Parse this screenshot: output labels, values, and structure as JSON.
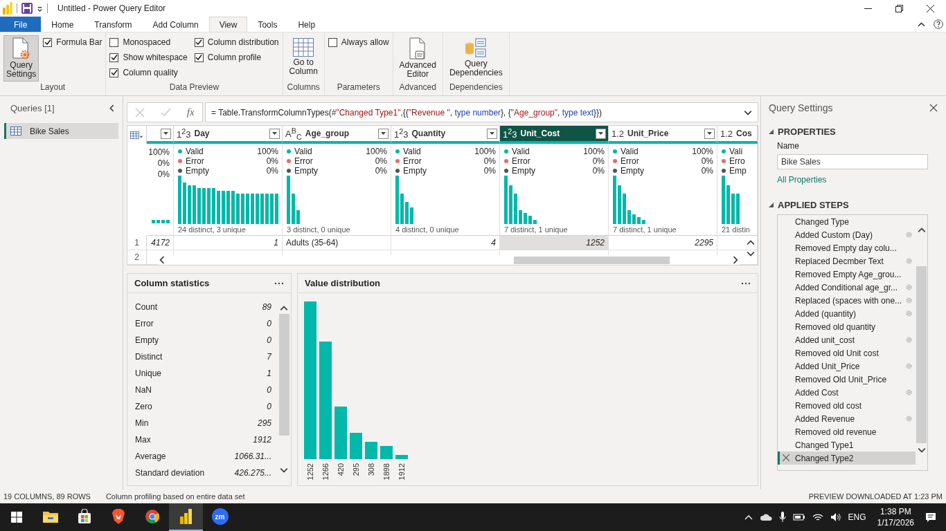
{
  "title_bar": {
    "title": "Untitled - Power Query Editor"
  },
  "ribbon_tabs": [
    {
      "label": "File",
      "kind": "file",
      "selected": false
    },
    {
      "label": "Home",
      "kind": "tab",
      "selected": false
    },
    {
      "label": "Transform",
      "kind": "tab",
      "selected": false
    },
    {
      "label": "Add Column",
      "kind": "tab",
      "selected": false
    },
    {
      "label": "View",
      "kind": "tab",
      "selected": true
    },
    {
      "label": "Tools",
      "kind": "tab",
      "selected": false
    },
    {
      "label": "Help",
      "kind": "tab",
      "selected": false
    }
  ],
  "ribbon_groups": [
    {
      "label": "Layout",
      "items": [
        {
          "kind": "big",
          "label": "Query Settings",
          "selected": true
        },
        {
          "kind": "check",
          "label": "Formula Bar",
          "checked": true
        }
      ]
    },
    {
      "label": "Data Preview",
      "items": [
        {
          "kind": "check",
          "label": "Monospaced",
          "checked": false
        },
        {
          "kind": "check",
          "label": "Show whitespace",
          "checked": true
        },
        {
          "kind": "check",
          "label": "Column quality",
          "checked": true
        },
        {
          "kind": "check",
          "label": "Column distribution",
          "checked": true
        },
        {
          "kind": "check",
          "label": "Column profile",
          "checked": true
        }
      ]
    },
    {
      "label": "Columns",
      "items": [
        {
          "kind": "big",
          "label": "Go to Column",
          "selected": false
        }
      ]
    },
    {
      "label": "Parameters",
      "items": [
        {
          "kind": "check",
          "label": "Always allow",
          "checked": false
        }
      ]
    },
    {
      "label": "Advanced",
      "items": [
        {
          "kind": "big",
          "label": "Advanced Editor",
          "selected": false
        }
      ]
    },
    {
      "label": "Dependencies",
      "items": [
        {
          "kind": "big",
          "label": "Query Dependencies",
          "selected": false
        }
      ]
    }
  ],
  "queries": {
    "title": "Queries [1]",
    "items": [
      {
        "label": "Bike Sales",
        "selected": true
      }
    ]
  },
  "formula_bar": {
    "function_label": "fx",
    "formula": "= Table.TransformColumnTypes(#\"Changed Type1\",{{\"Revenue \", type number}, {\"Age_group\", type text}})"
  },
  "grid": {
    "columns": [
      {
        "kind": "number",
        "selected": false,
        "quality": [
          {
            "value": "100%"
          },
          {
            "value": "0%"
          },
          {
            "value": "0%"
          }
        ]
      },
      {
        "kind": "number",
        "type_label": "1$^{2}$3",
        "name": "Day",
        "selected": false,
        "quality": [
          {
            "label": "Valid",
            "value": "100%",
            "color": "#01b8aa"
          },
          {
            "label": "Error",
            "value": "0%",
            "color": "#e66c6c"
          },
          {
            "label": "Empty",
            "value": "0%",
            "color": "#555555"
          }
        ],
        "distinct": "24 distinct, 3 unique"
      },
      {
        "kind": "text",
        "type_label": "A$^{B}$$_{C}$",
        "name": "Age_group",
        "selected": false,
        "quality": [
          {
            "label": "Valid",
            "value": "100%",
            "color": "#01b8aa"
          },
          {
            "label": "Error",
            "value": "0%",
            "color": "#e66c6c"
          },
          {
            "label": "Empty",
            "value": "0%",
            "color": "#555555"
          }
        ],
        "distinct": "3 distinct, 0 unique"
      },
      {
        "kind": "number",
        "type_label": "1$^{2}$3",
        "name": "Quantity",
        "selected": false,
        "quality": [
          {
            "label": "Valid",
            "value": "100%",
            "color": "#01b8aa"
          },
          {
            "label": "Error",
            "value": "0%",
            "color": "#e66c6c"
          },
          {
            "label": "Empty",
            "value": "0%",
            "color": "#555555"
          }
        ],
        "distinct": "4 distinct, 0 unique"
      },
      {
        "kind": "number",
        "type_label": "1$^{2}$3",
        "name": "Unit_Cost",
        "selected": true,
        "quality": [
          {
            "label": "Valid",
            "value": "100%",
            "color": "#01b8aa"
          },
          {
            "label": "Error",
            "value": "0%",
            "color": "#e66c6c"
          },
          {
            "label": "Empty",
            "value": "0%",
            "color": "#555555"
          }
        ],
        "distinct": "7 distinct, 1 unique"
      },
      {
        "kind": "number",
        "type_label": "1.2",
        "name": "Unit_Price",
        "selected": false,
        "quality": [
          {
            "label": "Valid",
            "value": "100%",
            "color": "#01b8aa"
          },
          {
            "label": "Error",
            "value": "0%",
            "color": "#e66c6c"
          },
          {
            "label": "Empty",
            "value": "0%",
            "color": "#555555"
          }
        ],
        "distinct": "7 distinct, 1 unique"
      },
      {
        "kind": "number",
        "type_label": "1.2",
        "name": "Cos",
        "selected": false,
        "quality": [
          {
            "label": "Vali",
            "color": "#01b8aa"
          },
          {
            "label": "Erro",
            "color": "#e66c6c"
          },
          {
            "label": "Emp",
            "color": "#555555"
          }
        ],
        "distinct": "21 distin"
      }
    ],
    "rows": [
      {
        "number": "1",
        "cells": [
          "4172",
          "1",
          "Adults (35-64)",
          "4",
          "1252",
          "2295"
        ]
      },
      {
        "number": "2",
        "cells": []
      }
    ]
  },
  "column_statistics": {
    "title": "Column statistics",
    "rows": [
      {
        "label": "Count",
        "value": "89"
      },
      {
        "label": "Error",
        "value": "0"
      },
      {
        "label": "Empty",
        "value": "0"
      },
      {
        "label": "Distinct",
        "value": "7"
      },
      {
        "label": "Unique",
        "value": "1"
      },
      {
        "label": "NaN",
        "value": "0"
      },
      {
        "label": "Zero",
        "value": "0"
      },
      {
        "label": "Min",
        "value": "295"
      },
      {
        "label": "Max",
        "value": "1912"
      },
      {
        "label": "Average",
        "value": "1066.31..."
      },
      {
        "label": "Standard deviation",
        "value": "426.275..."
      }
    ]
  },
  "value_distribution": {
    "title": "Value distribution",
    "labels": [
      "1252",
      "1266",
      "420",
      "295",
      "308",
      "1898",
      "1912"
    ]
  },
  "query_settings": {
    "title": "Query Settings",
    "properties": {
      "heading": "PROPERTIES",
      "name_label": "Name",
      "name_value": "Bike Sales",
      "link": "All Properties"
    },
    "applied_steps": {
      "heading": "APPLIED STEPS",
      "steps": [
        {
          "label": "Changed Type",
          "settings": false,
          "selected": false
        },
        {
          "label": "Added Custom (Day)",
          "settings": true,
          "selected": false
        },
        {
          "label": "Removed Empty day colu...",
          "settings": false,
          "selected": false
        },
        {
          "label": "Replaced Decmber Text",
          "settings": true,
          "selected": false
        },
        {
          "label": "Removed Empty Age_grou...",
          "settings": false,
          "selected": false
        },
        {
          "label": "Added Conditional age_gr...",
          "settings": true,
          "selected": false
        },
        {
          "label": "Replaced (spaces with one...",
          "settings": true,
          "selected": false
        },
        {
          "label": "Added (quantity)",
          "settings": true,
          "selected": false
        },
        {
          "label": "Removed old quantity",
          "settings": false,
          "selected": false
        },
        {
          "label": "Added unit_cost",
          "settings": true,
          "selected": false
        },
        {
          "label": "Removed old Unit cost",
          "settings": false,
          "selected": false
        },
        {
          "label": "Added Unit_Price",
          "settings": true,
          "selected": false
        },
        {
          "label": "Removed Old Unit_Price",
          "settings": false,
          "selected": false
        },
        {
          "label": "Added Cost",
          "settings": true,
          "selected": false
        },
        {
          "label": "Removed old cost",
          "settings": false,
          "selected": false
        },
        {
          "label": "Added Revenue",
          "settings": true,
          "selected": false
        },
        {
          "label": "Removed old revenue",
          "settings": false,
          "selected": false
        },
        {
          "label": "Changed Type1",
          "settings": false,
          "selected": false
        },
        {
          "label": "Changed Type2",
          "settings": false,
          "selected": true
        }
      ]
    }
  },
  "status_bar": {
    "left": [
      "19 COLUMNS, 89 ROWS",
      "Column profiling based on entire data set"
    ],
    "right": "PREVIEW DOWNLOADED AT 1:23 PM"
  },
  "taskbar": {
    "apps": [
      {
        "kind": "folder",
        "active": false
      },
      {
        "kind": "store",
        "active": false
      },
      {
        "kind": "lion",
        "active": false
      },
      {
        "kind": "chrome",
        "active": false
      },
      {
        "kind": "bars",
        "active": true
      },
      {
        "kind": "zoom",
        "label": "zm",
        "active": false
      }
    ],
    "language": "ENG",
    "time": "1:38 PM",
    "date": "1/17/2026"
  }
}
